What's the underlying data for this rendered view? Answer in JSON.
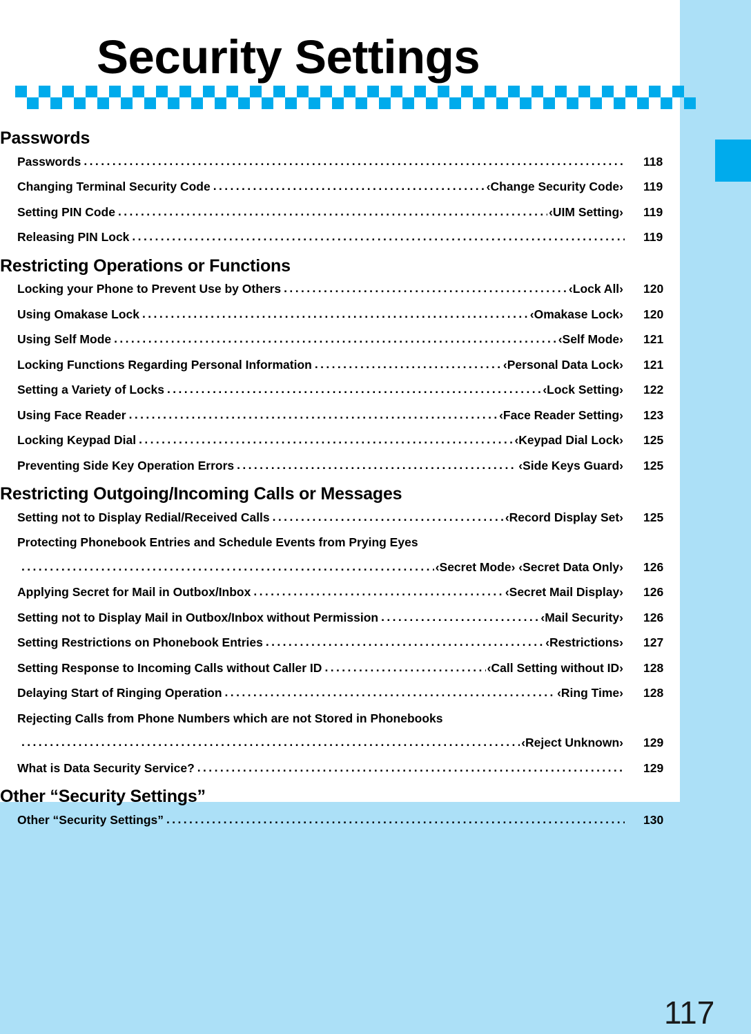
{
  "page": {
    "title": "Security Settings",
    "number": "117",
    "accent_color": "#00abec",
    "background_color": "#ace0f7",
    "panel_color": "#ffffff"
  },
  "tab_marker": {
    "name": "chapter-tab-marker",
    "color": "#00abec"
  },
  "toc": {
    "sections": [
      {
        "heading": "Passwords",
        "entries": [
          {
            "title": "Passwords",
            "ref": "",
            "page": "118"
          },
          {
            "title": "Changing Terminal Security Code",
            "ref": "‹Change Security Code›",
            "page": "119"
          },
          {
            "title": "Setting PIN Code",
            "ref": "‹UIM Setting›",
            "page": "119"
          },
          {
            "title": "Releasing PIN Lock",
            "ref": "",
            "page": "119"
          }
        ]
      },
      {
        "heading": "Restricting Operations or Functions",
        "entries": [
          {
            "title": "Locking your Phone to Prevent Use by Others",
            "ref": "‹Lock All›",
            "page": "120"
          },
          {
            "title": "Using Omakase Lock",
            "ref": "‹Omakase Lock›",
            "page": "120"
          },
          {
            "title": "Using Self Mode",
            "ref": "‹Self Mode›",
            "page": "121"
          },
          {
            "title": "Locking Functions Regarding Personal Information",
            "ref": "‹Personal Data Lock›",
            "page": "121"
          },
          {
            "title": "Setting a Variety of Locks",
            "ref": "‹Lock Setting›",
            "page": "122"
          },
          {
            "title": "Using Face Reader",
            "ref": "‹Face Reader Setting›",
            "page": "123"
          },
          {
            "title": "Locking Keypad Dial",
            "ref": "‹Keypad Dial Lock›",
            "page": "125"
          },
          {
            "title": "Preventing Side Key Operation Errors",
            "ref": "‹Side Keys Guard›",
            "page": "125"
          }
        ]
      },
      {
        "heading": "Restricting Outgoing/Incoming Calls or Messages",
        "entries": [
          {
            "title": "Setting not to Display Redial/Received Calls",
            "ref": "‹Record Display Set›",
            "page": "125"
          },
          {
            "title": "Protecting Phonebook Entries and Schedule Events from Prying Eyes",
            "ref": "‹Secret Mode› ‹Secret Data Only›",
            "page": "126",
            "wrapped": true
          },
          {
            "title": "Applying Secret for Mail in Outbox/Inbox",
            "ref": "‹Secret Mail Display›",
            "page": "126"
          },
          {
            "title": "Setting not to Display Mail in Outbox/Inbox without Permission",
            "ref": "‹Mail Security›",
            "page": "126"
          },
          {
            "title": "Setting Restrictions on Phonebook Entries",
            "ref": "‹Restrictions›",
            "page": "127"
          },
          {
            "title": "Setting Response to Incoming Calls without Caller ID",
            "ref": "‹Call Setting without ID›",
            "page": "128"
          },
          {
            "title": "Delaying Start of Ringing Operation",
            "ref": "‹Ring Time›",
            "page": "128"
          },
          {
            "title": "Rejecting Calls from Phone Numbers which are not Stored in Phonebooks",
            "ref": "‹Reject Unknown›",
            "page": "129",
            "wrapped": true
          },
          {
            "title": "What is Data Security Service?",
            "ref": "",
            "page": "129"
          }
        ]
      },
      {
        "heading": "Other “Security Settings”",
        "entries": [
          {
            "title": "Other “Security Settings”",
            "ref": "",
            "page": "130"
          }
        ]
      }
    ]
  }
}
